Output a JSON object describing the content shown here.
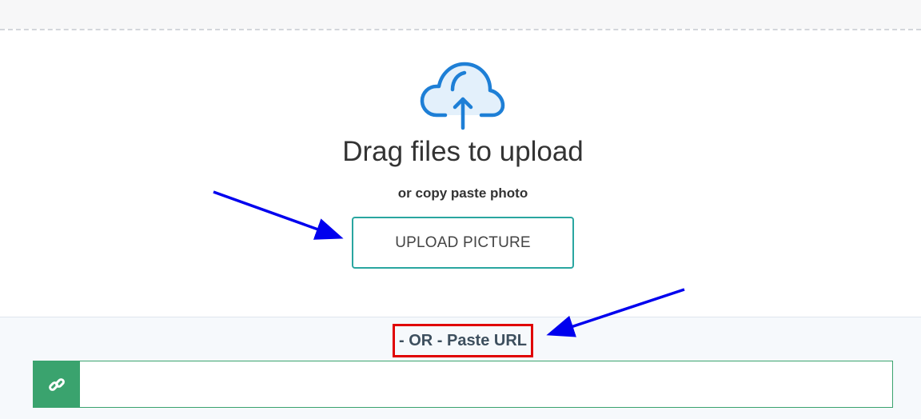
{
  "drop_zone": {
    "icon": "cloud-upload-icon",
    "title": "Drag files to upload",
    "subtitle": "or copy paste photo",
    "upload_button_label": "UPLOAD PICTURE"
  },
  "url_section": {
    "or_label": "- OR - Paste URL",
    "link_icon": "link-icon",
    "url_value": ""
  },
  "colors": {
    "icon_blue": "#1e7fd6",
    "button_border": "#2aa6a0",
    "addon_green": "#3aa36e",
    "highlight_red": "#e00000",
    "annotation_arrow": "#0000ee"
  }
}
